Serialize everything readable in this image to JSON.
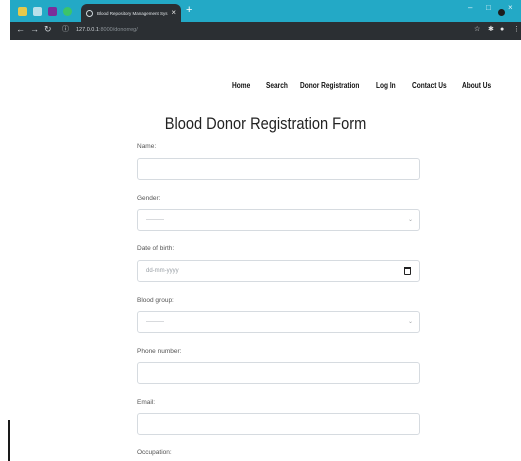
{
  "browser": {
    "tab_title": "Blood Repository Management Sys",
    "tab_close": "×",
    "new_tab": "+",
    "url_host": "127.0.0.1",
    "url_path": ":8000/donorreg/",
    "controls": {
      "minimize": "–",
      "maximize": "□",
      "close": "×"
    }
  },
  "nav": {
    "items": [
      "Home",
      "Search",
      "Donor Registration",
      "Log In",
      "Contact Us",
      "About Us"
    ]
  },
  "form": {
    "title": "Blood Donor Registration Form",
    "fields": [
      {
        "label": "Name:",
        "placeholder": ""
      },
      {
        "label": "Gender:",
        "placeholder": "---------"
      },
      {
        "label": "Date of birth:",
        "placeholder": "dd-mm-yyyy"
      },
      {
        "label": "Blood group:",
        "placeholder": "---------"
      },
      {
        "label": "Phone number:",
        "placeholder": ""
      },
      {
        "label": "Email:",
        "placeholder": ""
      },
      {
        "label": "Occupation:",
        "placeholder": ""
      }
    ]
  },
  "colors": {
    "tabbar": "#23a9c6",
    "chrome_dark": "#2b2f33"
  }
}
